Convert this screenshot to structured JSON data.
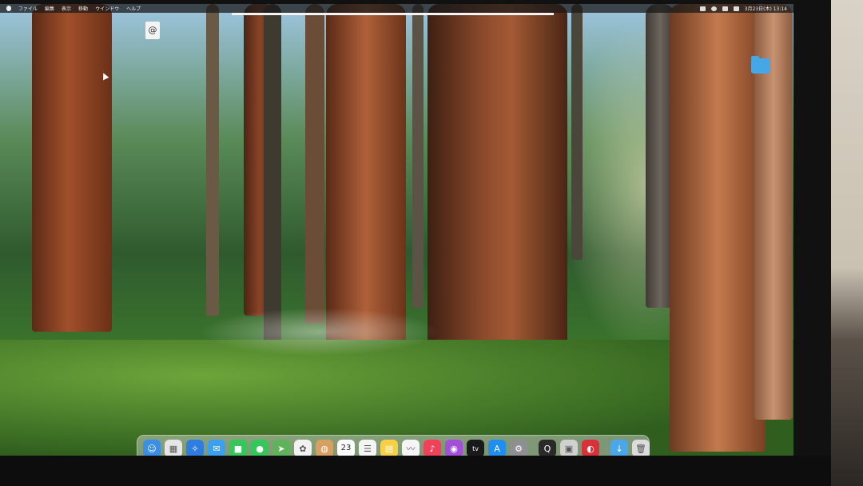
{
  "menubar": {
    "items": [
      "ファイル",
      "編集",
      "表示",
      "移動",
      "ウインドウ",
      "ヘルプ"
    ],
    "clock": "3月23日(木) 13:14"
  },
  "desktop": {
    "at_icon_glyph": "@",
    "folder_color": "#45a7e6"
  },
  "progress": {
    "fraction": 1.0
  },
  "dock": {
    "apps": [
      {
        "name": "finder",
        "glyph": "☺",
        "color": "#3a8ee6"
      },
      {
        "name": "launchpad",
        "glyph": "▦",
        "color": "#e6e6e6"
      },
      {
        "name": "safari",
        "glyph": "✧",
        "color": "#2f7de0"
      },
      {
        "name": "mail",
        "glyph": "✉",
        "color": "#3ba0f0"
      },
      {
        "name": "facetime",
        "glyph": "■",
        "color": "#35c759"
      },
      {
        "name": "messages",
        "glyph": "●",
        "color": "#34c759"
      },
      {
        "name": "maps",
        "glyph": "➤",
        "color": "#5fb35a"
      },
      {
        "name": "photos",
        "glyph": "✿",
        "color": "#f2f2f2"
      },
      {
        "name": "contacts",
        "glyph": "◍",
        "color": "#d8a060"
      },
      {
        "name": "calendar",
        "glyph": "",
        "color": "#ffffff",
        "day": "23",
        "month": ""
      },
      {
        "name": "reminders",
        "glyph": "☰",
        "color": "#f5f5f5"
      },
      {
        "name": "notes",
        "glyph": "▤",
        "color": "#f7d046"
      },
      {
        "name": "freeform",
        "glyph": "〰",
        "color": "#f5f5f5"
      },
      {
        "name": "music",
        "glyph": "♪",
        "color": "#f2405a"
      },
      {
        "name": "podcasts",
        "glyph": "◉",
        "color": "#a34fd9"
      },
      {
        "name": "apple-tv",
        "glyph": "tv",
        "color": "#1a1a1a"
      },
      {
        "name": "app-store",
        "glyph": "A",
        "color": "#1e8ef0"
      },
      {
        "name": "system-settings",
        "glyph": "⚙",
        "color": "#8e8e93"
      },
      {
        "name": "quicktime",
        "glyph": "Q",
        "color": "#2a2a2a"
      },
      {
        "name": "screenshot",
        "glyph": "▣",
        "color": "#d0d0d0"
      },
      {
        "name": "photo-booth",
        "glyph": "◐",
        "color": "#d9303a"
      },
      {
        "name": "downloads-folder",
        "glyph": "↓",
        "color": "#4aa8e8"
      },
      {
        "name": "trash",
        "glyph": "🗑",
        "color": "#dcdcdc"
      }
    ]
  }
}
